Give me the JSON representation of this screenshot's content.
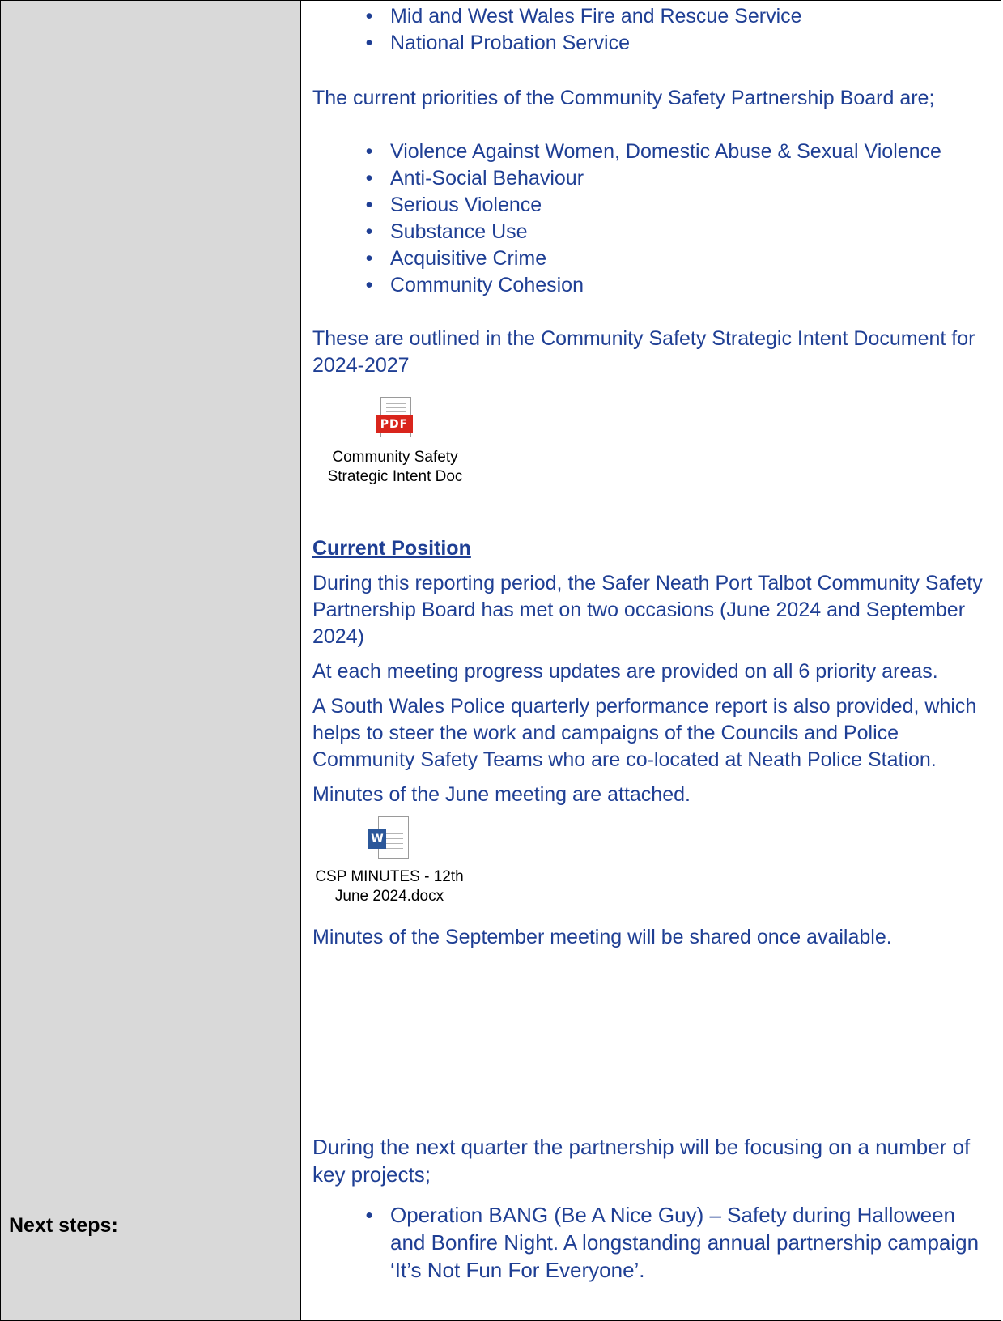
{
  "partners_cont": [
    "Mid and West Wales Fire and Rescue Service",
    "National Probation Service"
  ],
  "priorities_intro": "The current priorities of the Community Safety Partnership Board are;",
  "priorities": [
    "Violence Against Women, Domestic Abuse & Sexual Violence",
    "Anti-Social Behaviour",
    "Serious Violence",
    "Substance Use",
    "Acquisitive Crime",
    "Community Cohesion"
  ],
  "outline_text": "These are outlined in the Community Safety Strategic Intent Document for 2024-2027",
  "attachment_pdf": {
    "icon": "pdf-icon",
    "badge": "PDF",
    "line1": "Community Safety",
    "line2": "Strategic Intent Doc"
  },
  "current_position": {
    "heading": "Current Position",
    "para1": "During this reporting period, the Safer Neath Port Talbot Community Safety Partnership Board has met on two occasions (June 2024 and September 2024)",
    "para2": "At each meeting progress updates are provided on all 6 priority areas.",
    "para3": "A South Wales Police quarterly performance report is also provided, which helps to steer the work and campaigns of the Councils and Police Community Safety Teams who are co-located at Neath Police Station.",
    "para4": "Minutes of the June meeting are attached."
  },
  "attachment_doc": {
    "icon": "word-icon",
    "badge": "W",
    "line1": "CSP MINUTES - 12th",
    "line2": "June 2024.docx"
  },
  "september_note": "Minutes of the September meeting will be shared once available.",
  "next_steps": {
    "label": "Next steps:",
    "intro": "During the next quarter the partnership will be focusing on a number of key projects;",
    "items": [
      "Operation BANG (Be A Nice Guy) – Safety during Halloween and Bonfire Night. A longstanding annual partnership campaign ‘It’s Not Fun For Everyone’."
    ]
  },
  "colors": {
    "body_text": "#1f3f94",
    "label_bg": "#d9d9d9",
    "pdf_red": "#d9251c",
    "word_blue": "#2b579a"
  }
}
